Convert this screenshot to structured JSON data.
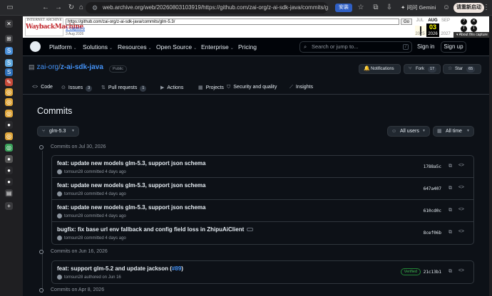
{
  "browser": {
    "url": "web.archive.org/web/20260803103919/https://github.com/zai-org/z-ai-sdk-java/commits/glm-5...",
    "install_label": "安装",
    "gemini_label": "问问 Gemini",
    "update_label": "请重新启动",
    "icons": [
      "sidebar-toggle-icon",
      "back-icon",
      "forward-icon",
      "reload-icon",
      "home-icon",
      "site-info-icon",
      "bookmark-icon",
      "profile-icon",
      "menu-icon"
    ]
  },
  "sidebar": {
    "items": [
      {
        "icon": "close-icon",
        "glyph": "✕",
        "color": "#3a3a3d"
      },
      {
        "icon": "tab-grid-icon",
        "glyph": "⊞",
        "color": "#3a3a3d"
      },
      {
        "icon": "app-icon",
        "glyph": "S",
        "color": "#4a8fd8"
      },
      {
        "icon": "app-icon",
        "glyph": "S",
        "color": "#5fa8e0"
      },
      {
        "icon": "app-icon",
        "glyph": "S",
        "color": "#2d6fb8"
      },
      {
        "icon": "feather-icon",
        "glyph": "✎",
        "color": "#c74b3a"
      },
      {
        "icon": "chrome-icon",
        "glyph": "◎",
        "color": "#e0a63a"
      },
      {
        "icon": "chrome-icon",
        "glyph": "◎",
        "color": "#e0a63a"
      },
      {
        "icon": "chrome-icon",
        "glyph": "◎",
        "color": "#e0a63a"
      },
      {
        "icon": "github-icon",
        "glyph": "●",
        "color": "#2a2a2d"
      },
      {
        "icon": "chrome-icon",
        "glyph": "◎",
        "color": "#e0a63a"
      },
      {
        "icon": "chrome-icon",
        "glyph": "◎",
        "color": "#3aa05a"
      },
      {
        "icon": "github-icon",
        "glyph": "●",
        "color": "#555"
      },
      {
        "icon": "github-icon",
        "glyph": "●",
        "color": "#2a2a2d"
      },
      {
        "icon": "github-icon",
        "glyph": "●",
        "color": "#2a2a2d"
      },
      {
        "icon": "page-icon",
        "glyph": "▤",
        "color": "#3a3a3d"
      },
      {
        "icon": "add-icon",
        "glyph": "+",
        "color": "#3a3a3d"
      }
    ]
  },
  "wayback": {
    "logo_top": "INTERNET ARCHIVE",
    "logo_main": "WaybackMachine",
    "url": "https://github.com/zai-org/z-ai-sdk-java/commits/glm-5.3/",
    "go_label": "Go",
    "captures": "1 capture",
    "capture_date": "3 Aug 2026",
    "months": {
      "prev": "JUL",
      "cur": "AUG",
      "next": "SEP"
    },
    "day": "03",
    "years": {
      "prev": "2025",
      "cur": "2026",
      "next": "2027"
    },
    "about": "▾ About this capture"
  },
  "github": {
    "nav": [
      "Platform",
      "Solutions",
      "Resources",
      "Open Source",
      "Enterprise",
      "Pricing"
    ],
    "search_placeholder": "Search or jump to...",
    "search_key": "/",
    "sign_in": "Sign in",
    "sign_up": "Sign up",
    "owner": "zai-org",
    "separator": "/",
    "repo": "z-ai-sdk-java",
    "visibility": "Public",
    "notifications_label": "Notifications",
    "fork_label": "Fork",
    "fork_count": "17",
    "star_label": "Star",
    "star_count": "65",
    "tabs": [
      {
        "label": "Code",
        "icon": "code-icon",
        "glyph": "<>"
      },
      {
        "label": "Issues",
        "icon": "issues-icon",
        "glyph": "⊙",
        "count": "3"
      },
      {
        "label": "Pull requests",
        "icon": "pull-request-icon",
        "glyph": "⇅",
        "count": "1"
      },
      {
        "label": "Actions",
        "icon": "actions-icon",
        "glyph": "▶"
      },
      {
        "label": "Projects",
        "icon": "projects-icon",
        "glyph": "▦"
      },
      {
        "label": "Security and quality",
        "icon": "shield-icon",
        "glyph": "⛉"
      },
      {
        "label": "Insights",
        "icon": "graph-icon",
        "glyph": "⟋"
      }
    ],
    "page_title": "Commits",
    "branch": "glm-5.3",
    "filter_users": "All users",
    "filter_time": "All time",
    "groups": [
      {
        "heading": "Commits on Jul 30, 2026",
        "commits": [
          {
            "message": "feat: update new models glm-5.3, support json schema",
            "author": "tomsun28",
            "action": "committed",
            "time": "4 days ago",
            "sha": "1788a5c"
          },
          {
            "message": "feat: update new models glm-5.3, support json schema",
            "author": "tomsun28",
            "action": "committed",
            "time": "4 days ago",
            "sha": "647a407"
          },
          {
            "message": "feat: update new models glm-5.3, support json schema",
            "author": "tomsun28",
            "action": "committed",
            "time": "4 days ago",
            "sha": "610cd0c"
          },
          {
            "message": "bugfix: fix base url env fallback and config field loss in ZhipuAiClient",
            "author": "tomsun28",
            "action": "committed",
            "time": "4 days ago",
            "sha": "8cef06b",
            "has_more": true
          }
        ]
      },
      {
        "heading": "Commits on Jun 16, 2026",
        "commits": [
          {
            "message": "feat: support glm-5.2 and update jackson (",
            "pr": "#89",
            "message_end": ")",
            "author": "tomsun28",
            "action": "authored",
            "time": "on Jun 16",
            "sha": "21c13b1",
            "verified": "Verified"
          }
        ]
      },
      {
        "heading": "Commits on Apr 8, 2026",
        "commits": []
      }
    ]
  }
}
